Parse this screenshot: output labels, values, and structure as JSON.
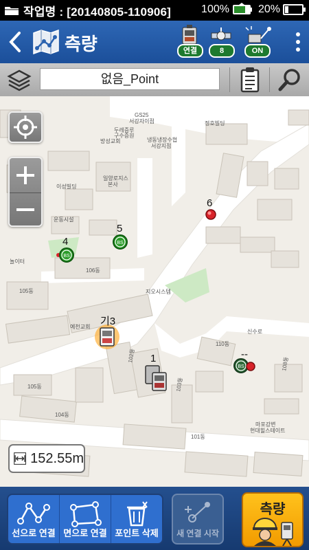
{
  "status_bar": {
    "title": "작업명 : [20140805-110906]",
    "signal_percent": "100%",
    "battery_percent": "20%",
    "battery_level": 0.2
  },
  "header": {
    "back_icon": "chevron-left-icon",
    "app_icon": "map-icon",
    "title": "측량",
    "connect_label": "연결",
    "satellite_count": "8",
    "laser_label": "ON"
  },
  "toolbar": {
    "layer_name": "없음_Point"
  },
  "map": {
    "points": [
      {
        "label": "6",
        "kind": "red-target"
      },
      {
        "label": "5",
        "kind": "bs-green"
      },
      {
        "label": "4",
        "kind": "bs-green-red"
      },
      {
        "label": "기3",
        "kind": "instrument-selected"
      },
      {
        "label": "1",
        "kind": "instrument"
      },
      {
        "label": "--",
        "kind": "bs-red"
      }
    ],
    "labels": {
      "gs25": "GS25",
      "gs25_sub": "서강자이점",
      "church_a": "두레증루",
      "church_b": "구수증원",
      "church_c": "방성교회",
      "temple": "냉동냉장수협",
      "temple_sub": "서강지점",
      "jeongho": "정호빌딩",
      "ilyang": "일양로지스",
      "ilyang_sub": "본사",
      "isung": "이성빌딩",
      "undong": "운동시설",
      "yemyeong": "예천교회",
      "jios": "지오시스템",
      "b105": "105동",
      "b106": "106동",
      "b110": "110동",
      "b105b": "105동",
      "b104": "104동",
      "b101": "101동",
      "b102": "102동",
      "b103": "103동",
      "b108": "108동",
      "hyundai": "마포강변",
      "hyundai_sub": "현대힐스테이트",
      "nori": "놀이터",
      "road_sinsu": "신수로"
    }
  },
  "scale": {
    "value": "152.55m"
  },
  "bottom": {
    "line_connect": "선으로 연결",
    "area_connect": "면으로 연결",
    "point_delete": "포인트 삭제",
    "new_connect": "새 연결 시작",
    "survey": "측량"
  }
}
